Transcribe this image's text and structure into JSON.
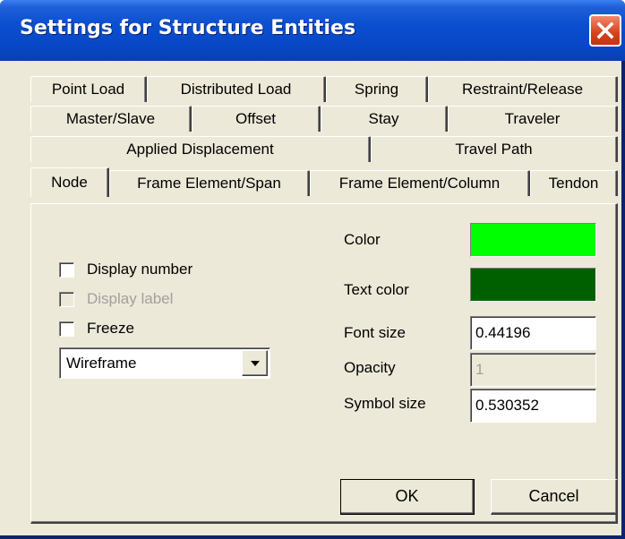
{
  "window": {
    "title": "Settings for Structure Entities"
  },
  "tabs": {
    "row1": [
      "Point Load",
      "Distributed Load",
      "Spring",
      "Restraint/Release"
    ],
    "row2": [
      "Master/Slave",
      "Offset",
      "Stay",
      "Traveler"
    ],
    "row3": [
      "Applied Displacement",
      "Travel Path"
    ],
    "row4": [
      "Node",
      "Frame Element/Span",
      "Frame Element/Column",
      "Tendon"
    ],
    "active": "Node"
  },
  "node_settings": {
    "display_number_label": "Display number",
    "display_label_label": "Display label",
    "freeze_label": "Freeze",
    "display_number_checked": false,
    "display_label_checked": false,
    "freeze_checked": false,
    "render_mode": "Wireframe",
    "color_label": "Color",
    "text_color_label": "Text color",
    "font_size_label": "Font size",
    "opacity_label": "Opacity",
    "symbol_size_label": "Symbol size",
    "color": "#00ff00",
    "text_color": "#006000",
    "font_size": "0.44196",
    "opacity": "1",
    "symbol_size": "0.530352"
  },
  "buttons": {
    "ok": "OK",
    "cancel": "Cancel"
  },
  "icons": {
    "close": "close-icon",
    "dropdown": "chevron-down-icon"
  }
}
